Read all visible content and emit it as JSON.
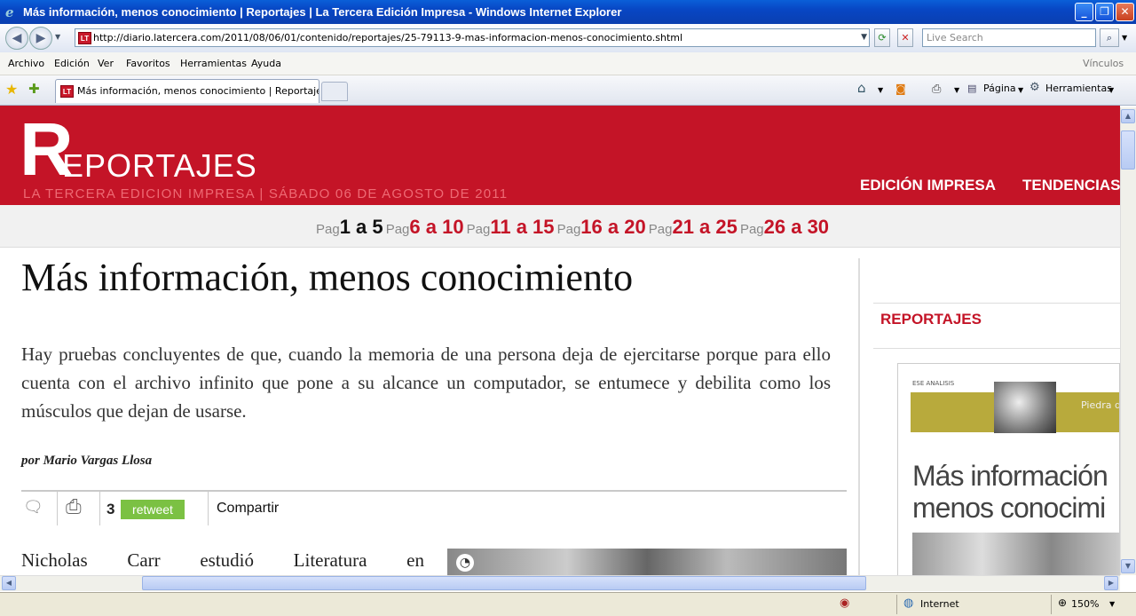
{
  "window": {
    "title": "Más información, menos conocimiento | Reportajes | La Tercera Edición Impresa - Windows Internet Explorer",
    "min": "_",
    "max": "❐",
    "close": "✕"
  },
  "address": {
    "url": "http://diario.latercera.com/2011/08/06/01/contenido/reportajes/25-79113-9-mas-informacion-menos-conocimiento.shtml",
    "favicon": "LT",
    "search_placeholder": "Live Search"
  },
  "menu": {
    "items": [
      "Archivo",
      "Edición",
      "Ver",
      "Favoritos",
      "Herramientas",
      "Ayuda"
    ],
    "links": "Vínculos"
  },
  "tabs": {
    "active_label": "Más información, menos conocimiento | Reportajes | L...",
    "pagina": "Página",
    "herramientas": "Herramientas"
  },
  "banner": {
    "logo_letter": "R",
    "logo_text": "EPORTAJES",
    "subline": "LA TERCERA EDICION IMPRESA | SÁBADO 06 DE AGOSTO DE 2011",
    "nav": [
      "EDICIÓN IMPRESA",
      "TENDENCIAS"
    ]
  },
  "pagination": {
    "prefix": "Pag",
    "ranges": [
      "1 a 5",
      "6 a 10",
      "11 a 15",
      "16 a 20",
      "21 a 25",
      "26 a 30"
    ],
    "current_index": 0
  },
  "article": {
    "title": "Más información, menos conocimiento",
    "lead": "Hay pruebas concluyentes de que, cuando la memoria de una persona deja de ejercitarse porque para ello cuenta con el archivo infinito que pone a su alcance un computador, se entumece y debilita como los músculos que dejan de usarse.",
    "byline": "por Mario Vargas Llosa",
    "body_words": [
      "Nicholas",
      "Carr",
      "estudió",
      "Literatura",
      "en"
    ]
  },
  "share": {
    "count": "3",
    "retweet": "retweet",
    "compartir": "Compartir"
  },
  "sidebar": {
    "heading": "REPORTAJES",
    "promo_header": "ESE ANALISIS",
    "promo_band": "Piedra de\nMario V",
    "promo_line1": "Más información",
    "promo_line2": "menos conocimi"
  },
  "status": {
    "zone": "Internet",
    "zoom": "150%"
  }
}
